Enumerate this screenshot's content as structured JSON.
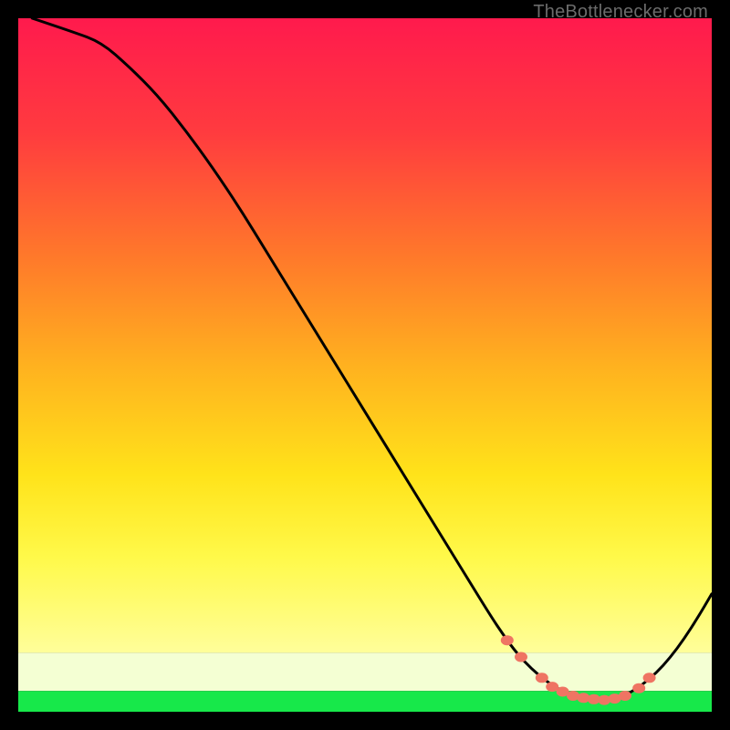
{
  "watermark": "TheBottlenecker.com",
  "chart_data": {
    "type": "line",
    "title": "",
    "xlabel": "",
    "ylabel": "",
    "xlim": [
      0,
      100
    ],
    "ylim": [
      0,
      100
    ],
    "series": [
      {
        "name": "bottleneck-curve",
        "x": [
          2,
          8,
          12,
          16,
          20,
          24,
          28,
          32,
          36,
          40,
          44,
          48,
          52,
          56,
          60,
          64,
          68,
          70,
          72,
          74,
          76,
          78,
          80,
          82,
          84,
          86,
          88,
          90,
          92,
          94,
          96,
          98,
          100
        ],
        "y": [
          100,
          98,
          96.5,
          93,
          89,
          84,
          78.5,
          72.5,
          66,
          59.5,
          53,
          46.5,
          40,
          33.5,
          27,
          20.5,
          14,
          11,
          8.3,
          6.2,
          4.5,
          3.2,
          2.4,
          1.9,
          1.7,
          1.9,
          2.6,
          3.9,
          5.6,
          7.8,
          10.5,
          13.6,
          17
        ]
      }
    ],
    "markers": {
      "name": "highlight-dots",
      "color": "#ef7463",
      "x": [
        70.5,
        72.5,
        75.5,
        77,
        78.5,
        80,
        81.5,
        83,
        84.5,
        86,
        87.5,
        89.5,
        91
      ],
      "y": [
        10.3,
        7.9,
        4.9,
        3.6,
        2.9,
        2.3,
        2.0,
        1.8,
        1.7,
        1.9,
        2.3,
        3.4,
        4.9
      ]
    },
    "green_band": {
      "y0": 0,
      "y1": 3.0
    },
    "pale_band": {
      "y0": 3.0,
      "y1": 8.5
    },
    "gradient_stops": [
      {
        "offset": 0.0,
        "color": "#ff1a4d"
      },
      {
        "offset": 0.18,
        "color": "#ff3b3f"
      },
      {
        "offset": 0.38,
        "color": "#ff7a2a"
      },
      {
        "offset": 0.55,
        "color": "#ffb21f"
      },
      {
        "offset": 0.72,
        "color": "#ffe31a"
      },
      {
        "offset": 0.85,
        "color": "#fff94a"
      },
      {
        "offset": 1.0,
        "color": "#fffe9a"
      }
    ]
  }
}
